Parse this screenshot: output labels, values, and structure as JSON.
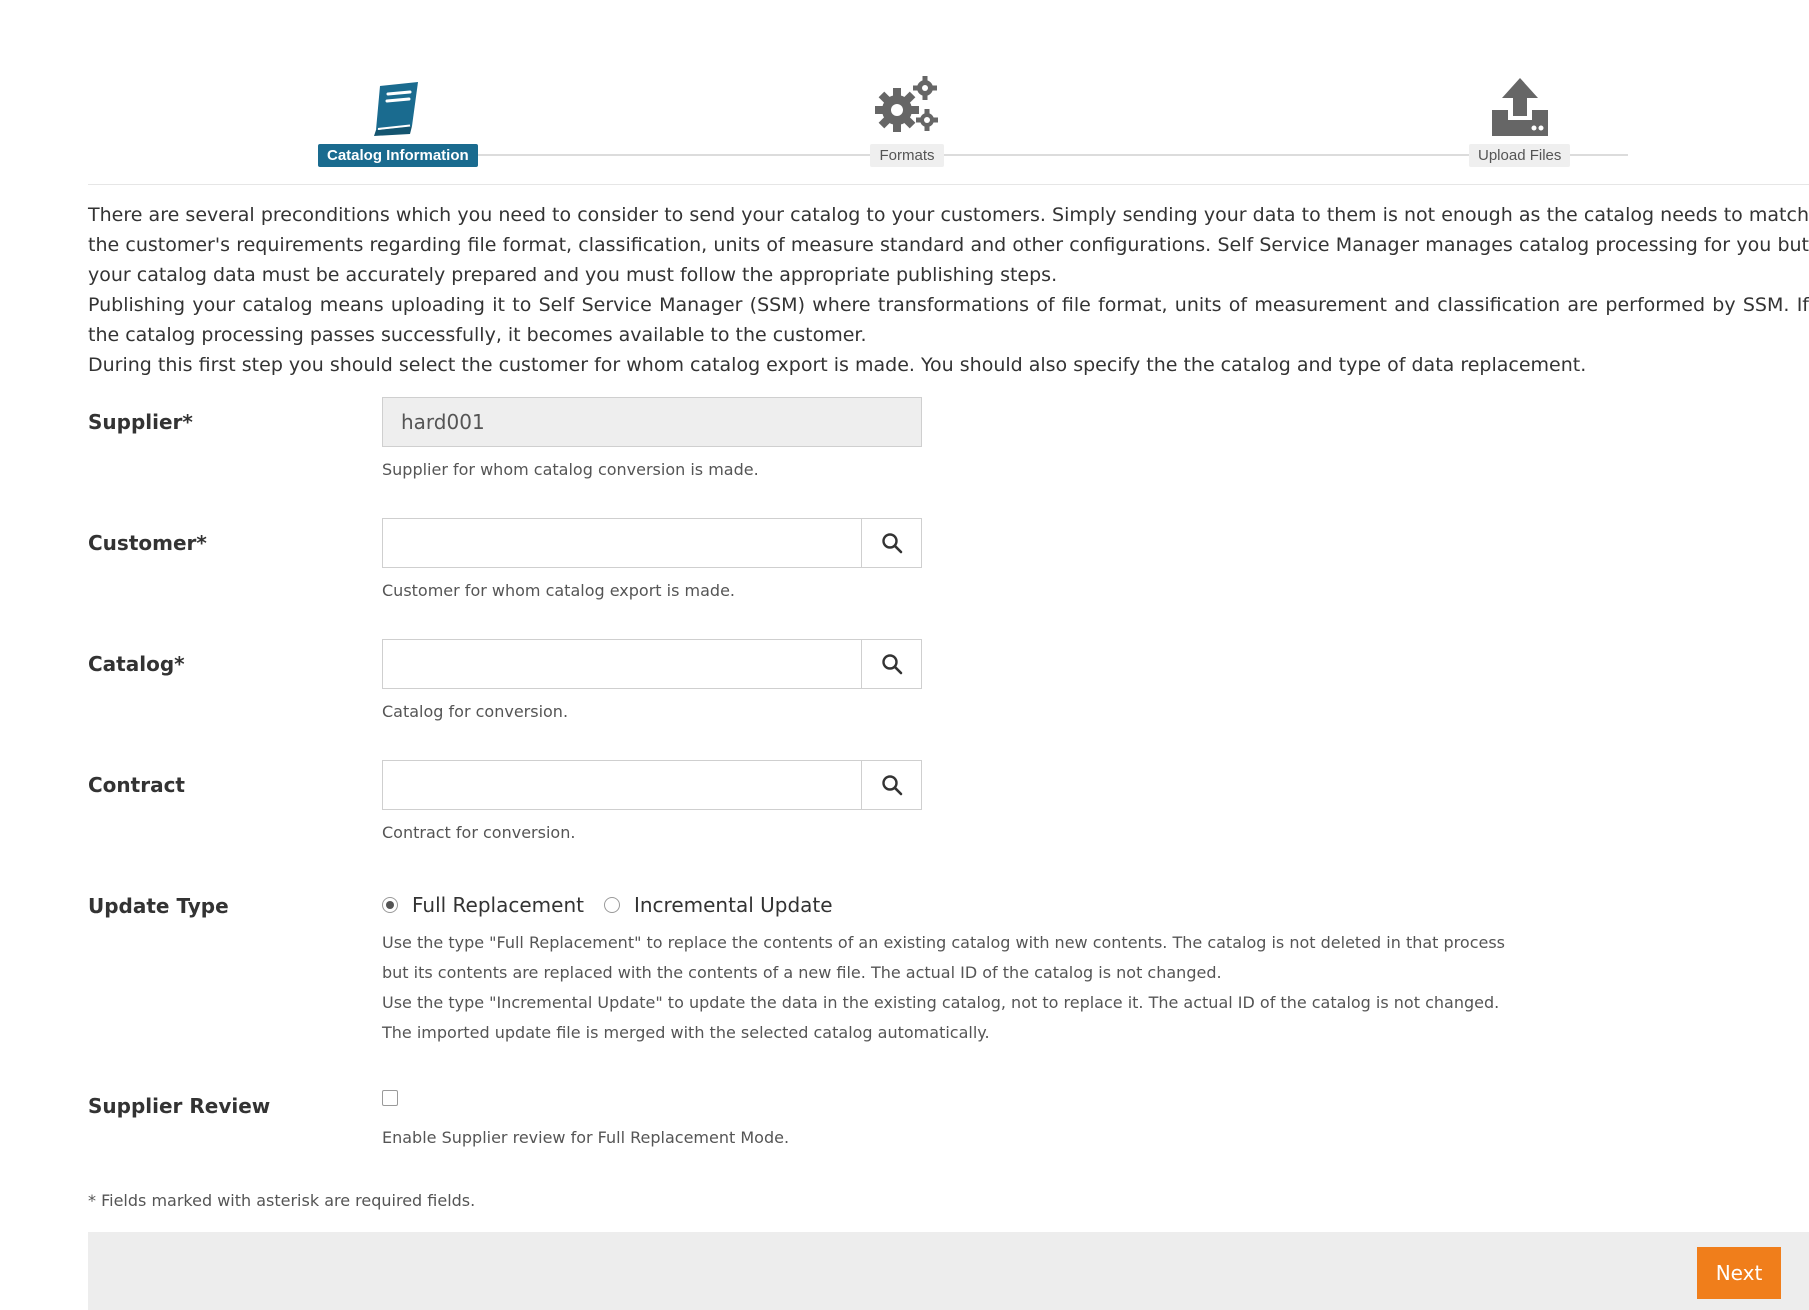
{
  "stepper": {
    "steps": [
      {
        "label": "Catalog Information",
        "icon": "book-icon",
        "active": true
      },
      {
        "label": "Formats",
        "icon": "gears-icon",
        "active": false
      },
      {
        "label": "Upload Files",
        "icon": "upload-icon",
        "active": false
      }
    ]
  },
  "intro": {
    "p1": "There are several preconditions which you need to consider to send your catalog to your customers. Simply sending your data to them is not enough as the catalog needs to match the customer's requirements regarding file format, classification, units of measure standard and other configurations. Self Service Manager manages catalog processing for you but your catalog data must be accurately prepared and you must follow the appropriate publishing steps.",
    "p2": "Publishing your catalog means uploading it to Self Service Manager (SSM) where transformations of file format, units of measurement and classification are performed by SSM. If the catalog processing passes successfully, it becomes available to the customer.",
    "p3": "During this first step you should select the customer for whom catalog export is made. You should also specify the the catalog and type of data replacement."
  },
  "form": {
    "supplier": {
      "label": "Supplier*",
      "value": "hard001",
      "help": "Supplier for whom catalog conversion is made."
    },
    "customer": {
      "label": "Customer*",
      "value": "",
      "help": "Customer for whom catalog export is made."
    },
    "catalog": {
      "label": "Catalog*",
      "value": "",
      "help": "Catalog for conversion."
    },
    "contract": {
      "label": "Contract",
      "value": "",
      "help": "Contract for conversion."
    },
    "update_type": {
      "label": "Update Type",
      "options": [
        {
          "label": "Full Replacement",
          "checked": true
        },
        {
          "label": "Incremental Update",
          "checked": false
        }
      ],
      "help1": "Use the type \"Full Replacement\" to replace the contents of an existing catalog with new contents. The catalog is not deleted in that process but its contents are replaced with the contents of a new file. The actual ID of the catalog is not changed.",
      "help2": "Use the type \"Incremental Update\" to update the data in the existing catalog, not to replace it. The actual ID of the catalog is not changed. The imported update file is merged with the selected catalog automatically."
    },
    "supplier_review": {
      "label": "Supplier Review",
      "checked": false,
      "help": "Enable Supplier review for Full Replacement Mode."
    }
  },
  "required_note": "* Fields marked with asterisk are required fields.",
  "footer": {
    "next_label": "Next"
  },
  "colors": {
    "accent": "#1a6b8f",
    "primary_button": "#f07e1b",
    "footer_bg": "#ededed"
  }
}
